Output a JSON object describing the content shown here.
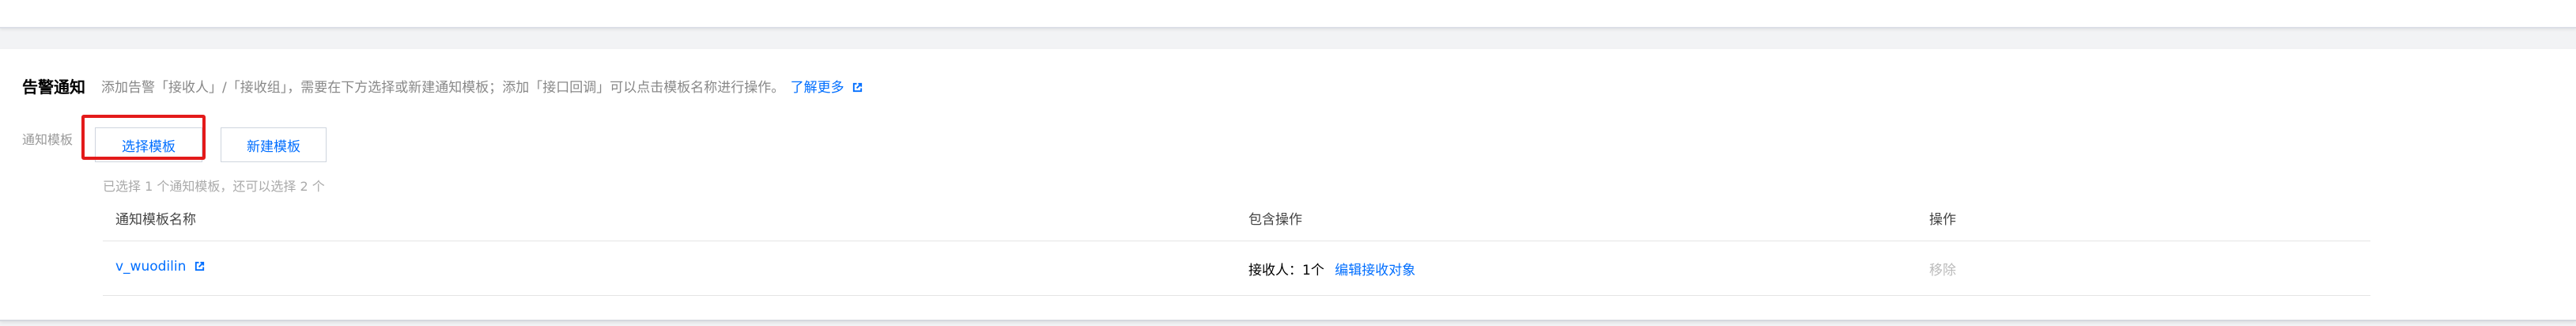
{
  "section": {
    "title": "告警通知",
    "description": "添加告警「接收人」/「接收组」，需要在下方选择或新建通知模板；添加「接口回调」可以点击模板名称进行操作。",
    "learn_more": "了解更多"
  },
  "form": {
    "label": "通知模板",
    "select_button": "选择模板",
    "new_button": "新建模板",
    "selected_info": "已选择 1 个通知模板，还可以选择 2 个"
  },
  "table": {
    "columns": [
      "通知模板名称",
      "包含操作",
      "操作"
    ],
    "rows": [
      {
        "name": "v_wuodilin",
        "receivers": "接收人：1个",
        "edit_action": "编辑接收对象",
        "remove_action": "移除"
      }
    ]
  },
  "colors": {
    "accent": "#006eff",
    "highlight": "#e31a1a"
  },
  "icons": {
    "external_link": "external-link-icon"
  }
}
